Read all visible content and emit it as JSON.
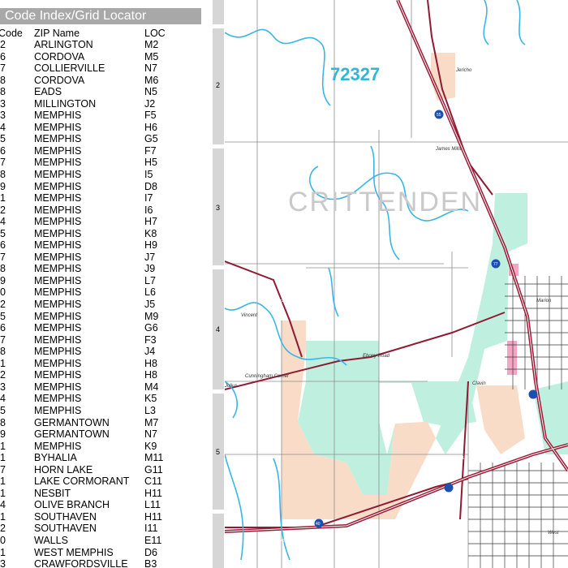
{
  "index": {
    "title": "Code Index/Grid Locator",
    "header": {
      "code": "Code",
      "name": "ZIP Name",
      "loc": "LOC"
    },
    "rows": [
      {
        "code": "2",
        "name": "ARLINGTON",
        "loc": "M2"
      },
      {
        "code": "6",
        "name": "CORDOVA",
        "loc": "M5"
      },
      {
        "code": "7",
        "name": "COLLIERVILLE",
        "loc": "N7"
      },
      {
        "code": "8",
        "name": "CORDOVA",
        "loc": "M6"
      },
      {
        "code": "8",
        "name": "EADS",
        "loc": "N5"
      },
      {
        "code": "3",
        "name": "MILLINGTON",
        "loc": "J2"
      },
      {
        "code": "3",
        "name": "MEMPHIS",
        "loc": "F5"
      },
      {
        "code": "4",
        "name": "MEMPHIS",
        "loc": "H6"
      },
      {
        "code": "5",
        "name": "MEMPHIS",
        "loc": "G5"
      },
      {
        "code": "6",
        "name": "MEMPHIS",
        "loc": "F7"
      },
      {
        "code": "7",
        "name": "MEMPHIS",
        "loc": "H5"
      },
      {
        "code": "8",
        "name": "MEMPHIS",
        "loc": "I5"
      },
      {
        "code": "9",
        "name": "MEMPHIS",
        "loc": "D8"
      },
      {
        "code": "1",
        "name": "MEMPHIS",
        "loc": "I7"
      },
      {
        "code": "2",
        "name": "MEMPHIS",
        "loc": "I6"
      },
      {
        "code": "4",
        "name": "MEMPHIS",
        "loc": "H7"
      },
      {
        "code": "5",
        "name": "MEMPHIS",
        "loc": "K8"
      },
      {
        "code": "6",
        "name": "MEMPHIS",
        "loc": "H9"
      },
      {
        "code": "7",
        "name": "MEMPHIS",
        "loc": "J7"
      },
      {
        "code": "8",
        "name": "MEMPHIS",
        "loc": "J9"
      },
      {
        "code": "9",
        "name": "MEMPHIS",
        "loc": "L7"
      },
      {
        "code": "0",
        "name": "MEMPHIS",
        "loc": "L6"
      },
      {
        "code": "2",
        "name": "MEMPHIS",
        "loc": "J5"
      },
      {
        "code": "5",
        "name": "MEMPHIS",
        "loc": "M9"
      },
      {
        "code": "6",
        "name": "MEMPHIS",
        "loc": "G6"
      },
      {
        "code": "7",
        "name": "MEMPHIS",
        "loc": "F3"
      },
      {
        "code": "8",
        "name": "MEMPHIS",
        "loc": "J4"
      },
      {
        "code": "1",
        "name": "MEMPHIS",
        "loc": "H8"
      },
      {
        "code": "2",
        "name": "MEMPHIS",
        "loc": "H8"
      },
      {
        "code": "3",
        "name": "MEMPHIS",
        "loc": "M4"
      },
      {
        "code": "4",
        "name": "MEMPHIS",
        "loc": "K5"
      },
      {
        "code": "5",
        "name": "MEMPHIS",
        "loc": "L3"
      },
      {
        "code": "8",
        "name": "GERMANTOWN",
        "loc": "M7"
      },
      {
        "code": "9",
        "name": "GERMANTOWN",
        "loc": "N7"
      },
      {
        "code": "1",
        "name": "MEMPHIS",
        "loc": "K9"
      },
      {
        "code": "1",
        "name": "BYHALIA",
        "loc": "M11"
      },
      {
        "code": "7",
        "name": "HORN LAKE",
        "loc": "G11"
      },
      {
        "code": "1",
        "name": "LAKE CORMORANT",
        "loc": "C11"
      },
      {
        "code": "1",
        "name": "NESBIT",
        "loc": "H11"
      },
      {
        "code": "4",
        "name": "OLIVE BRANCH",
        "loc": "L11"
      },
      {
        "code": "1",
        "name": "SOUTHAVEN",
        "loc": "H11"
      },
      {
        "code": "2",
        "name": "SOUTHAVEN",
        "loc": "I11"
      },
      {
        "code": "0",
        "name": "WALLS",
        "loc": "E11"
      },
      {
        "code": "1",
        "name": "WEST MEMPHIS",
        "loc": "D6"
      },
      {
        "code": "3",
        "name": "CRAWFORDSVILLE",
        "loc": "B3"
      }
    ]
  },
  "grid_rows": [
    "2",
    "3",
    "4",
    "5"
  ],
  "map": {
    "zip_label": "72327",
    "county_label": "CRITTENDEN",
    "places": [
      "Jericho",
      "James Mills",
      "Marion",
      "Vincent",
      "Julius",
      "Cunningham Corner",
      "Ebony Road",
      "Clavin",
      "West"
    ],
    "routes": [
      "55",
      "77",
      "64",
      "40",
      "118",
      "70",
      "149"
    ],
    "colors": {
      "water": "#3ab6e6",
      "interstate": "#9c1b36",
      "urban": "#bff0df",
      "land_tan": "#f9dcc7",
      "zip_text": "#31b6d9",
      "county_text": "#c9c9c9",
      "panel_title_bg": "#a8a8a8"
    }
  }
}
